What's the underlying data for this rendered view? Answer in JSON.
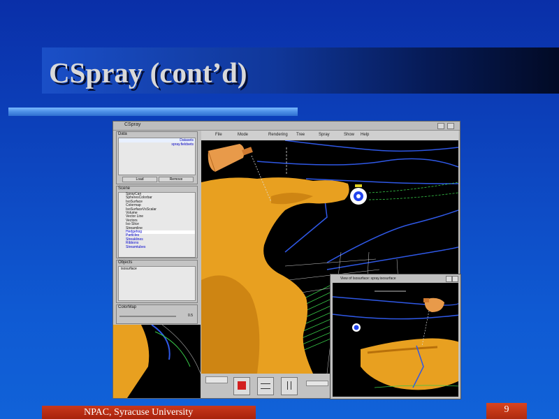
{
  "slide": {
    "title": "CSpray (cont’d)",
    "footer": "NPAC, Syracuse University",
    "page_number": "9"
  },
  "screenshot": {
    "window_title": "CSpray",
    "menu": [
      "File",
      "Mode",
      "Rendering",
      "Tree",
      "Spray",
      "Show",
      "Help"
    ],
    "panels": {
      "data_label": "Data",
      "data_entries": [
        "Datasets",
        "spray.fieldsets"
      ],
      "data_buttons": [
        "Load",
        "Remove"
      ],
      "scene_label": "Scene",
      "scene_items": [
        "SprayCan",
        "SpheresColorbar",
        "IsoSurface",
        "Colormap",
        "IsoSurfaceVsScalar",
        "Volume",
        "Vector Line",
        "Vectors",
        "Iso Slice",
        "Streamline",
        "Hedgehog",
        "Particles",
        "Streaklines",
        "Ribbons",
        "Streamtubes"
      ],
      "objects_label": "Objects",
      "objects_value": "isosurface",
      "colormap_label": "ColorMap",
      "colormap_value": "0.5"
    },
    "inset_title": "View of Isosurface: spray.isosurface",
    "colors": {
      "surface": "#e8a020",
      "bottle": "#e89a4a",
      "contour": "#2f58e6",
      "grid": "#38c848",
      "spray_ball": "#2244ee"
    }
  }
}
